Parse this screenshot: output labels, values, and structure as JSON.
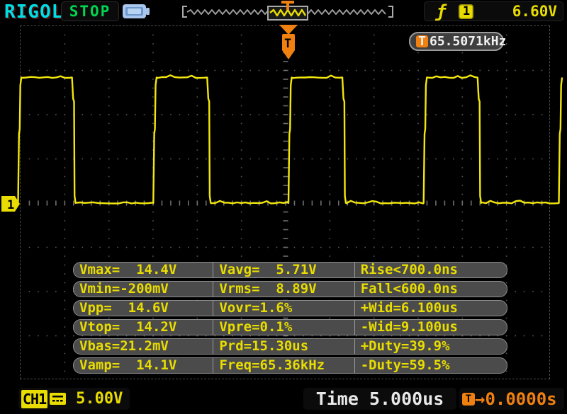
{
  "colors": {
    "background": "#000000",
    "channel1_yellow": "#e8dc00",
    "waveform_yellow": "#f2e70c",
    "brand_cyan": "#00dde4",
    "run_green": "#00d450",
    "trigger_orange": "#f08010",
    "panel_gray": "#4b4b4b",
    "grid_gray": "#585858",
    "readout_white": "#f0f0f0",
    "usb_blue": "#a9c6ee"
  },
  "top_bar": {
    "brand": "RIGOL",
    "run_state": "STOP",
    "usb_icon": "usb-device",
    "hpos_trigger_glyph": "T",
    "trigger_readout": {
      "slope_icon_glyph": "ƒ",
      "source": "1",
      "level": "6.60V"
    }
  },
  "trigger_frequency": {
    "icon_glyph": "T",
    "value": "65.5071kHz"
  },
  "channel_marker": {
    "label": "1"
  },
  "trigger_marker": {
    "label": "T"
  },
  "measurements": {
    "rows": [
      [
        "Vmax=  14.4V",
        "Vavg=  5.71V",
        "Rise<700.0ns"
      ],
      [
        "Vmin=-200mV",
        "Vrms=  8.89V",
        "Fall<600.0ns"
      ],
      [
        "Vpp=  14.6V",
        "Vovr=1.6%",
        "+Wid=6.100us"
      ],
      [
        "Vtop=  14.2V",
        "Vpre=0.1%",
        "-Wid=9.100us"
      ],
      [
        "Vbas=21.2mV",
        "Prd=15.30us",
        "+Duty=39.9%"
      ],
      [
        "Vamp=  14.1V",
        "Freq=65.36kHz",
        "-Duty=59.5%"
      ]
    ]
  },
  "bottom_bar": {
    "channel": {
      "label": "CH1",
      "coupling_icon": "dc-coupling",
      "scale": "5.00V"
    },
    "timebase": {
      "label": "Time",
      "value": "5.000us"
    },
    "trigger_position": {
      "icon_glyph": "T",
      "value": "→0.0000s"
    }
  },
  "waveform": {
    "type": "line",
    "channel": "CH1",
    "volts_per_div": 5.0,
    "time_per_div_us": 5.0,
    "divisions": {
      "horizontal": 12,
      "vertical": 8
    },
    "high_v": 14.2,
    "low_v": 0.02,
    "period_us": 15.3,
    "positive_width_us": 6.1,
    "trigger_offset_s": "0.0000",
    "rising_edge_at_trigger": true
  }
}
